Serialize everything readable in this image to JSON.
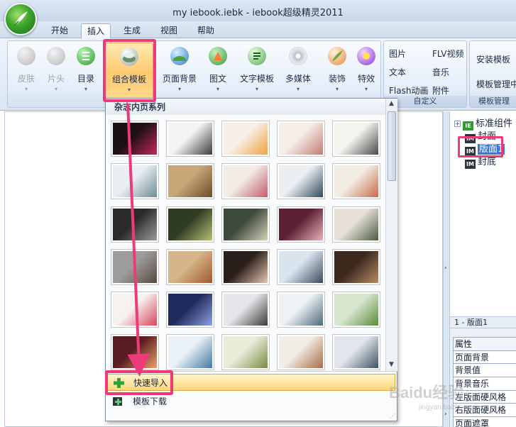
{
  "window": {
    "title": "my iebook.iebk - iebook超级精灵2011"
  },
  "tabs": [
    {
      "label": "开始",
      "active": false
    },
    {
      "label": "插入",
      "active": true
    },
    {
      "label": "生成",
      "active": false
    },
    {
      "label": "视图",
      "active": false
    },
    {
      "label": "帮助",
      "active": false
    }
  ],
  "ribbon": {
    "buttons": [
      {
        "label": "皮肤",
        "enabled": false,
        "icon": "skin-icon"
      },
      {
        "label": "片头",
        "enabled": false,
        "icon": "intro-icon"
      },
      {
        "label": "目录",
        "enabled": true,
        "icon": "toc-icon"
      },
      {
        "label": "组合模板",
        "enabled": true,
        "highlighted": true,
        "icon": "combo-template-icon"
      },
      {
        "label": "页面背景",
        "enabled": true,
        "icon": "page-background-icon"
      },
      {
        "label": "图文",
        "enabled": true,
        "icon": "image-text-icon"
      },
      {
        "label": "文字模板",
        "enabled": true,
        "icon": "text-template-icon"
      },
      {
        "label": "多媒体",
        "enabled": true,
        "icon": "multimedia-icon"
      },
      {
        "label": "装饰",
        "enabled": true,
        "icon": "decoration-icon"
      },
      {
        "label": "特效",
        "enabled": true,
        "icon": "effects-icon"
      }
    ],
    "custom_group": {
      "items": [
        "图片",
        "FLV视频",
        "文本",
        "音乐",
        "Flash动画",
        "附件"
      ],
      "label": "自定义"
    },
    "template_group": {
      "items": [
        "安装模板",
        "模板管理中"
      ],
      "label": "模板管理"
    }
  },
  "dropdown": {
    "header": "杂志内页系列",
    "menu": [
      {
        "label": "快速导入",
        "active": true,
        "icon": "green-plus-icon"
      },
      {
        "label": "模板下载",
        "active": false,
        "icon": "download-plus-icon"
      }
    ]
  },
  "tree": {
    "items": [
      {
        "label": "标准组件",
        "icon": "ie-component-icon"
      },
      {
        "label": "封面",
        "icon": "im-page-icon"
      },
      {
        "label": "版面1",
        "icon": "im-page-icon",
        "selected": true
      },
      {
        "label": "封底",
        "icon": "im-page-icon"
      }
    ]
  },
  "properties": {
    "title": "1 - 版面1",
    "header": "属性",
    "rows": [
      "页面背景",
      "背景值",
      "背景音乐",
      "左版面硬风格",
      "右版面硬风格",
      "页面遮罩"
    ]
  },
  "watermark": {
    "text": "Baidu经验",
    "sub": "jingyan.baidu.com"
  },
  "colors": {
    "highlight": "#ee3a78",
    "ribbon_bg": "#dbe6f3",
    "active_item": "#ffd67b"
  }
}
